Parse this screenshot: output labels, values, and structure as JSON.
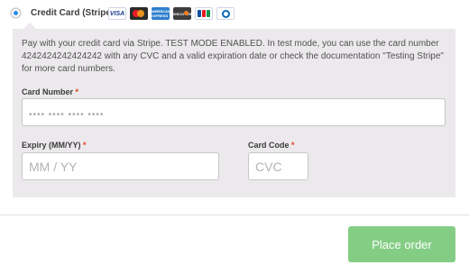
{
  "payment_method": {
    "label": "Credit Card (Stripe)",
    "selected": true,
    "card_icons": [
      {
        "icon": "visa-icon",
        "text": "VISA"
      },
      {
        "icon": "mastercard-icon",
        "text": ""
      },
      {
        "icon": "amex-icon",
        "text": "AMERICAN EXPRESS"
      },
      {
        "icon": "discover-icon",
        "text": "DISCOVER"
      },
      {
        "icon": "jcb-icon",
        "text": ""
      },
      {
        "icon": "diners-club-icon",
        "text": ""
      }
    ]
  },
  "description": "Pay with your credit card via Stripe. TEST MODE ENABLED. In test mode, you can use the card number 4242424242424242 with any CVC and a valid expiration date or check the documentation \"Testing Stripe\" for more card numbers.",
  "fields": {
    "card_number": {
      "label": "Card Number",
      "required_mark": "*",
      "placeholder": "•••• •••• •••• ••••",
      "value": ""
    },
    "expiry": {
      "label": "Expiry (MM/YY)",
      "required_mark": "*",
      "placeholder": "MM / YY",
      "value": ""
    },
    "card_code": {
      "label": "Card Code",
      "required_mark": "*",
      "placeholder": "CVC",
      "value": ""
    }
  },
  "place_order": {
    "label": "Place order"
  },
  "colors": {
    "accent": "#2e8ae6",
    "button": "#84cd85",
    "panel": "#ebe9eb",
    "required": "#e2401c"
  }
}
